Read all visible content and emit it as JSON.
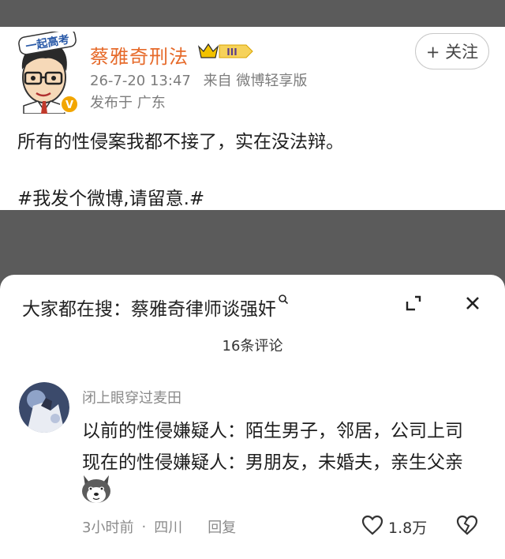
{
  "post": {
    "author": "蔡雅奇刑法",
    "level_badge": "III",
    "timestamp": "26-7-20 13:47",
    "source": "来自 微博轻享版",
    "location": "发布于 广东",
    "follow_label": "+ 关注",
    "text": "所有的性侵案我都不接了，实在没法辩。",
    "topic": "#我发个微博,请留意.#",
    "avatar_caption": "一起高考",
    "verified_mark": "V"
  },
  "comments_panel": {
    "search_hint": "大家都在搜：蔡雅奇律师谈强奸",
    "count_label": "16条评论",
    "comment": {
      "username": "闭上眼穿过麦田",
      "line1": "以前的性侵嫌疑人：陌生男子，邻居，公司上司",
      "line2": "现在的性侵嫌疑人：男朋友，未婚夫，亲生父亲",
      "time": "3小时前",
      "location": "四川",
      "reply_label": "回复",
      "likes": "1.8万"
    }
  },
  "colors": {
    "author_name": "#e66a2a",
    "badge_gold": "#d9a400",
    "badge_purple": "#5a3d8a",
    "verified": "#f2a600"
  }
}
